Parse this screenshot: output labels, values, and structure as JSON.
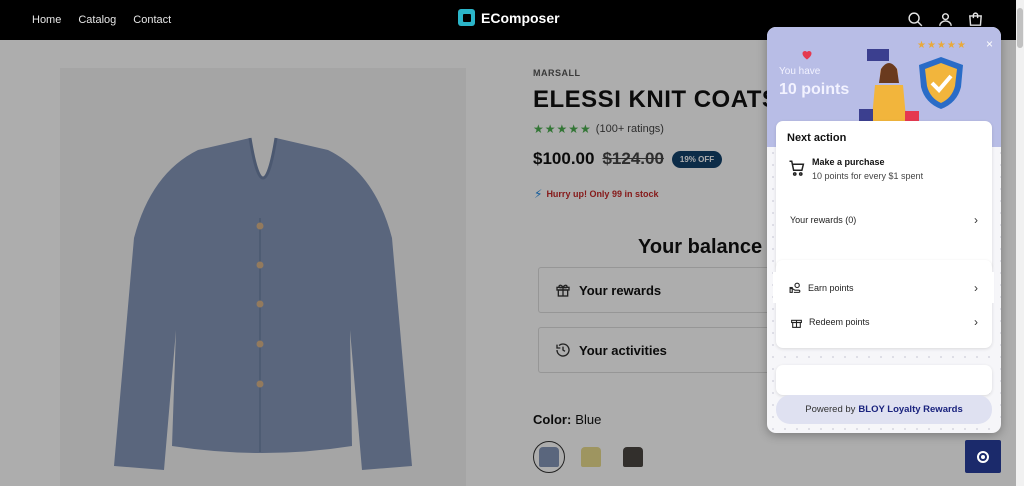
{
  "header": {
    "nav": [
      "Home",
      "Catalog",
      "Contact"
    ],
    "logo": "EComposer",
    "icons": [
      "search-icon",
      "account-icon",
      "cart-icon"
    ]
  },
  "product": {
    "vendor": "MARSALL",
    "title": "ELESSI KNIT COATS",
    "stars": "★★★★★",
    "rating_text": "(100+ ratings)",
    "price": "$100.00",
    "compare_price": "$124.00",
    "discount": "19% OFF",
    "stock_text": "Hurry up! Only 99 in stock",
    "color_label": "Color:",
    "color_value": "Blue",
    "swatch_colors": [
      "#8597b9",
      "#e9dc8e",
      "#4a4642"
    ]
  },
  "balance": {
    "title": "Your balance",
    "rewards_label": "Your rewards",
    "activities_label": "Your activities"
  },
  "widget": {
    "you_have": "You have",
    "points": "10 points",
    "next_action_title": "Next action",
    "action_title": "Make a purchase",
    "action_desc": "10 points for every $1 spent",
    "your_rewards": "Your rewards (0)",
    "earn_points": "Earn points",
    "redeem_points": "Redeem points",
    "powered_prefix": "Powered by",
    "powered_brand": "BLOY Loyalty Rewards",
    "hero_stars": "★★★★★",
    "close": "×"
  },
  "colors": {
    "accent": "#1b2a6b",
    "discount_badge": "#12416b",
    "stock_text": "#c62828",
    "stars": "#4caf50",
    "hero_bg": "#b8bde6"
  }
}
